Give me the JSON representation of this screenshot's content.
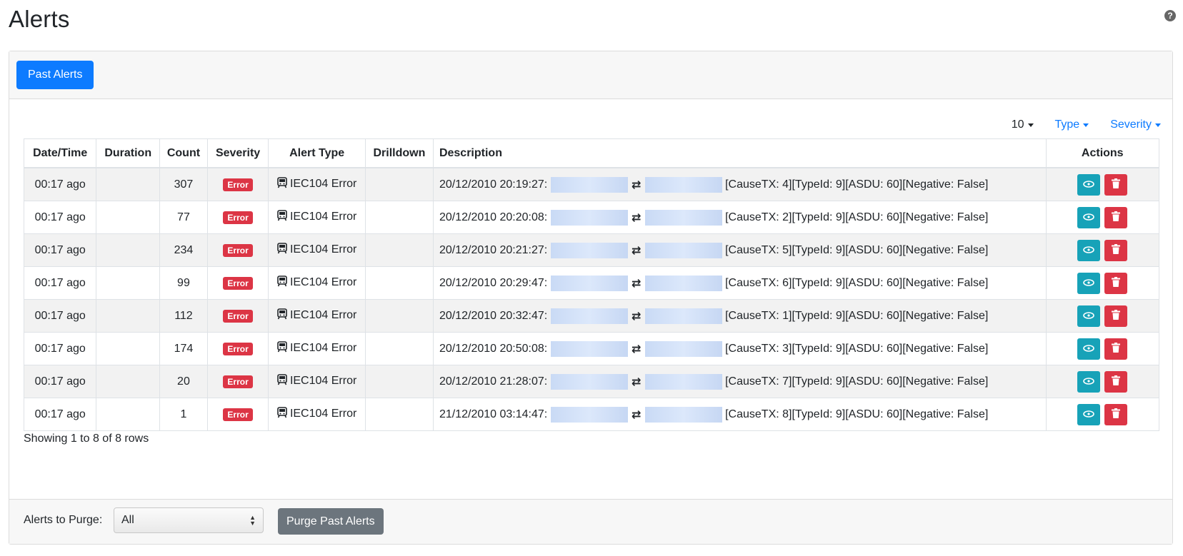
{
  "page": {
    "title": "Alerts",
    "help_glyph": "?"
  },
  "header": {
    "past_alerts_label": "Past Alerts"
  },
  "toolbar": {
    "page_size": "10",
    "type_label": "Type",
    "severity_label": "Severity"
  },
  "table": {
    "columns": [
      "Date/Time",
      "Duration",
      "Count",
      "Severity",
      "Alert Type",
      "Drilldown",
      "Description",
      "Actions"
    ],
    "rows": [
      {
        "datetime": "00:17 ago",
        "duration": "",
        "count": "307",
        "severity": "Error",
        "alert_type": "IEC104 Error",
        "drilldown": "",
        "desc_time": "20/12/2010 20:19:27:",
        "desc_detail": "[CauseTX: 4][TypeId: 9][ASDU: 60][Negative: False]"
      },
      {
        "datetime": "00:17 ago",
        "duration": "",
        "count": "77",
        "severity": "Error",
        "alert_type": "IEC104 Error",
        "drilldown": "",
        "desc_time": "20/12/2010 20:20:08:",
        "desc_detail": "[CauseTX: 2][TypeId: 9][ASDU: 60][Negative: False]"
      },
      {
        "datetime": "00:17 ago",
        "duration": "",
        "count": "234",
        "severity": "Error",
        "alert_type": "IEC104 Error",
        "drilldown": "",
        "desc_time": "20/12/2010 20:21:27:",
        "desc_detail": "[CauseTX: 5][TypeId: 9][ASDU: 60][Negative: False]"
      },
      {
        "datetime": "00:17 ago",
        "duration": "",
        "count": "99",
        "severity": "Error",
        "alert_type": "IEC104 Error",
        "drilldown": "",
        "desc_time": "20/12/2010 20:29:47:",
        "desc_detail": "[CauseTX: 6][TypeId: 9][ASDU: 60][Negative: False]"
      },
      {
        "datetime": "00:17 ago",
        "duration": "",
        "count": "112",
        "severity": "Error",
        "alert_type": "IEC104 Error",
        "drilldown": "",
        "desc_time": "20/12/2010 20:32:47:",
        "desc_detail": "[CauseTX: 1][TypeId: 9][ASDU: 60][Negative: False]"
      },
      {
        "datetime": "00:17 ago",
        "duration": "",
        "count": "174",
        "severity": "Error",
        "alert_type": "IEC104 Error",
        "drilldown": "",
        "desc_time": "20/12/2010 20:50:08:",
        "desc_detail": "[CauseTX: 3][TypeId: 9][ASDU: 60][Negative: False]"
      },
      {
        "datetime": "00:17 ago",
        "duration": "",
        "count": "20",
        "severity": "Error",
        "alert_type": "IEC104 Error",
        "drilldown": "",
        "desc_time": "20/12/2010 21:28:07:",
        "desc_detail": "[CauseTX: 7][TypeId: 9][ASDU: 60][Negative: False]"
      },
      {
        "datetime": "00:17 ago",
        "duration": "",
        "count": "1",
        "severity": "Error",
        "alert_type": "IEC104 Error",
        "drilldown": "",
        "desc_time": "21/12/2010 03:14:47:",
        "desc_detail": "[CauseTX: 8][TypeId: 9][ASDU: 60][Negative: False]"
      }
    ],
    "icons": {
      "alert_type": "train-icon",
      "swap": "swap-arrows-icon",
      "view": "eye-icon",
      "delete": "trash-icon"
    }
  },
  "pagination": {
    "summary": "Showing 1 to 8 of 8 rows"
  },
  "footer": {
    "purge_label": "Alerts to Purge:",
    "purge_select_value": "All",
    "purge_button_label": "Purge Past Alerts"
  },
  "colors": {
    "primary": "#0d7bff",
    "danger": "#dc3545",
    "info": "#17a2b8",
    "secondary": "#6c757d"
  }
}
